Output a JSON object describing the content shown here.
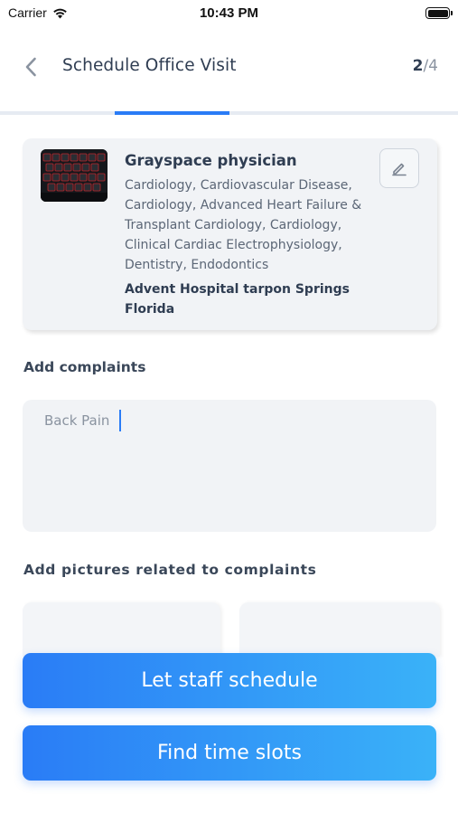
{
  "status_bar": {
    "carrier": "Carrier",
    "time": "10:43 PM"
  },
  "header": {
    "title": "Schedule Office Visit",
    "step_current": "2",
    "step_total": "/4"
  },
  "progress": {
    "total_steps": 4,
    "current_step": 2,
    "active_color": "#2a7cf6",
    "track_color": "#e6ebf2"
  },
  "doctor": {
    "name": "Grayspace physician",
    "specialties": "Cardiology, Cardiovascular Disease, Cardiology, Advanced Heart Failure & Transplant Cardiology, Cardiology, Clinical Cardiac Electrophysiology, Dentistry, Endodontics",
    "hospital": "Advent Hospital tarpon Springs Florida",
    "photo_icon": "doctor-photo",
    "edit_icon": "pencil-icon"
  },
  "complaints": {
    "label": "Add complaints",
    "value": "Back Pain"
  },
  "pictures": {
    "label": "Add pictures related to complaints"
  },
  "actions": {
    "staff_schedule": "Let staff schedule",
    "find_slots": "Find time slots"
  },
  "colors": {
    "accent": "#2a7cf6",
    "accent_end": "#3ab2f8",
    "card_bg": "#f1f3f6",
    "text_dark": "#2f3d52"
  }
}
